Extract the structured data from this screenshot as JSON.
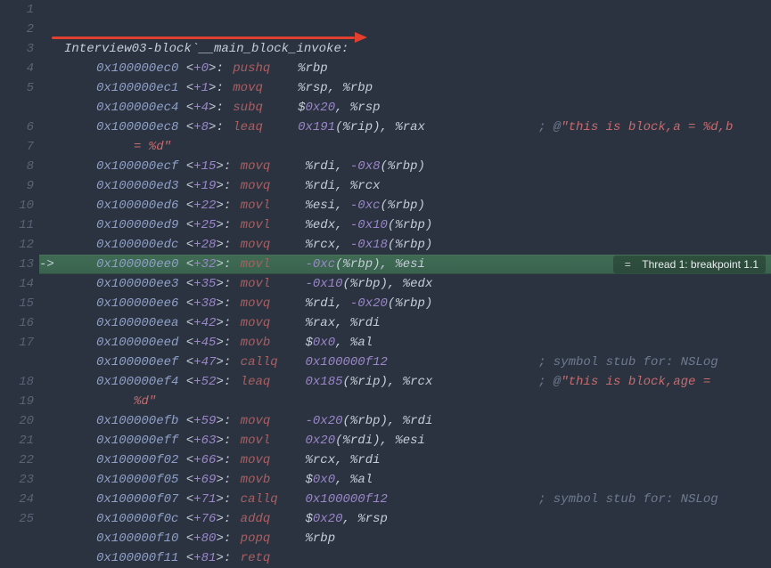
{
  "header": "Interview03-block`__main_block_invoke:",
  "breakpoint_badge": {
    "label": "Thread 1: breakpoint 1.1"
  },
  "current_line_index": 10,
  "lines": [
    {
      "ln": 1,
      "type": "header"
    },
    {
      "ln": 2,
      "addr": "0x100000ec0",
      "off": "+0",
      "mnem": "pushq",
      "ops": [
        {
          "t": "reg",
          "v": "%rbp"
        }
      ]
    },
    {
      "ln": 3,
      "addr": "0x100000ec1",
      "off": "+1",
      "mnem": "movq",
      "ops": [
        {
          "t": "reg",
          "v": "%rsp"
        },
        {
          "t": "sep",
          "v": ", "
        },
        {
          "t": "reg",
          "v": "%rbp"
        }
      ]
    },
    {
      "ln": 4,
      "addr": "0x100000ec4",
      "off": "+4",
      "mnem": "subq",
      "ops": [
        {
          "t": "reg",
          "v": "$"
        },
        {
          "t": "num",
          "v": "0x20"
        },
        {
          "t": "sep",
          "v": ", "
        },
        {
          "t": "reg",
          "v": "%rsp"
        }
      ]
    },
    {
      "ln": 5,
      "addr": "0x100000ec8",
      "off": "+8",
      "mnem": "leaq",
      "ops": [
        {
          "t": "num",
          "v": "0x191"
        },
        {
          "t": "reg",
          "v": "(%rip)"
        },
        {
          "t": "sep",
          "v": ", "
        },
        {
          "t": "reg",
          "v": "%rax"
        }
      ],
      "tail_comment": "; @",
      "tail_string": "\"this is block,a = %d,b",
      "wrap_string": "= %d\""
    },
    {
      "ln": 6,
      "addr": "0x100000ecf",
      "off": "+15",
      "mnem": "movq",
      "ops": [
        {
          "t": "reg",
          "v": "%rdi"
        },
        {
          "t": "sep",
          "v": ", "
        },
        {
          "t": "num",
          "v": "-0x8"
        },
        {
          "t": "reg",
          "v": "(%rbp)"
        }
      ]
    },
    {
      "ln": 7,
      "addr": "0x100000ed3",
      "off": "+19",
      "mnem": "movq",
      "ops": [
        {
          "t": "reg",
          "v": "%rdi"
        },
        {
          "t": "sep",
          "v": ", "
        },
        {
          "t": "reg",
          "v": "%rcx"
        }
      ]
    },
    {
      "ln": 8,
      "addr": "0x100000ed6",
      "off": "+22",
      "mnem": "movl",
      "ops": [
        {
          "t": "reg",
          "v": "%esi"
        },
        {
          "t": "sep",
          "v": ", "
        },
        {
          "t": "num",
          "v": "-0xc"
        },
        {
          "t": "reg",
          "v": "(%rbp)"
        }
      ]
    },
    {
      "ln": 9,
      "addr": "0x100000ed9",
      "off": "+25",
      "mnem": "movl",
      "ops": [
        {
          "t": "reg",
          "v": "%edx"
        },
        {
          "t": "sep",
          "v": ", "
        },
        {
          "t": "num",
          "v": "-0x10"
        },
        {
          "t": "reg",
          "v": "(%rbp)"
        }
      ]
    },
    {
      "ln": 10,
      "addr": "0x100000edc",
      "off": "+28",
      "mnem": "movq",
      "ops": [
        {
          "t": "reg",
          "v": "%rcx"
        },
        {
          "t": "sep",
          "v": ", "
        },
        {
          "t": "num",
          "v": "-0x18"
        },
        {
          "t": "reg",
          "v": "(%rbp)"
        }
      ]
    },
    {
      "ln": 11,
      "addr": "0x100000ee0",
      "off": "+32",
      "mnem": "movl",
      "ops": [
        {
          "t": "num",
          "v": "-0xc"
        },
        {
          "t": "reg",
          "v": "(%rbp)"
        },
        {
          "t": "sep",
          "v": ", "
        },
        {
          "t": "reg",
          "v": "%esi"
        }
      ],
      "current": true
    },
    {
      "ln": 12,
      "addr": "0x100000ee3",
      "off": "+35",
      "mnem": "movl",
      "ops": [
        {
          "t": "num",
          "v": "-0x10"
        },
        {
          "t": "reg",
          "v": "(%rbp)"
        },
        {
          "t": "sep",
          "v": ", "
        },
        {
          "t": "reg",
          "v": "%edx"
        }
      ]
    },
    {
      "ln": 13,
      "addr": "0x100000ee6",
      "off": "+38",
      "mnem": "movq",
      "ops": [
        {
          "t": "reg",
          "v": "%rdi"
        },
        {
          "t": "sep",
          "v": ", "
        },
        {
          "t": "num",
          "v": "-0x20"
        },
        {
          "t": "reg",
          "v": "(%rbp)"
        }
      ]
    },
    {
      "ln": 14,
      "addr": "0x100000eea",
      "off": "+42",
      "mnem": "movq",
      "ops": [
        {
          "t": "reg",
          "v": "%rax"
        },
        {
          "t": "sep",
          "v": ", "
        },
        {
          "t": "reg",
          "v": "%rdi"
        }
      ]
    },
    {
      "ln": 15,
      "addr": "0x100000eed",
      "off": "+45",
      "mnem": "movb",
      "ops": [
        {
          "t": "reg",
          "v": "$"
        },
        {
          "t": "num",
          "v": "0x0"
        },
        {
          "t": "sep",
          "v": ", "
        },
        {
          "t": "reg",
          "v": "%al"
        }
      ]
    },
    {
      "ln": 16,
      "addr": "0x100000eef",
      "off": "+47",
      "mnem": "callq",
      "ops": [
        {
          "t": "num",
          "v": "0x100000f12"
        }
      ],
      "tail_comment": "; symbol stub for: NSLog"
    },
    {
      "ln": 17,
      "addr": "0x100000ef4",
      "off": "+52",
      "mnem": "leaq",
      "ops": [
        {
          "t": "num",
          "v": "0x185"
        },
        {
          "t": "reg",
          "v": "(%rip)"
        },
        {
          "t": "sep",
          "v": ", "
        },
        {
          "t": "reg",
          "v": "%rcx"
        }
      ],
      "tail_comment": "; @",
      "tail_string": "\"this is block,age = ",
      "wrap_string": "%d\""
    },
    {
      "ln": 18,
      "addr": "0x100000efb",
      "off": "+59",
      "mnem": "movq",
      "ops": [
        {
          "t": "num",
          "v": "-0x20"
        },
        {
          "t": "reg",
          "v": "(%rbp)"
        },
        {
          "t": "sep",
          "v": ", "
        },
        {
          "t": "reg",
          "v": "%rdi"
        }
      ]
    },
    {
      "ln": 19,
      "addr": "0x100000eff",
      "off": "+63",
      "mnem": "movl",
      "ops": [
        {
          "t": "num",
          "v": "0x20"
        },
        {
          "t": "reg",
          "v": "(%rdi)"
        },
        {
          "t": "sep",
          "v": ", "
        },
        {
          "t": "reg",
          "v": "%esi"
        }
      ]
    },
    {
      "ln": 20,
      "addr": "0x100000f02",
      "off": "+66",
      "mnem": "movq",
      "ops": [
        {
          "t": "reg",
          "v": "%rcx"
        },
        {
          "t": "sep",
          "v": ", "
        },
        {
          "t": "reg",
          "v": "%rdi"
        }
      ]
    },
    {
      "ln": 21,
      "addr": "0x100000f05",
      "off": "+69",
      "mnem": "movb",
      "ops": [
        {
          "t": "reg",
          "v": "$"
        },
        {
          "t": "num",
          "v": "0x0"
        },
        {
          "t": "sep",
          "v": ", "
        },
        {
          "t": "reg",
          "v": "%al"
        }
      ]
    },
    {
      "ln": 22,
      "addr": "0x100000f07",
      "off": "+71",
      "mnem": "callq",
      "ops": [
        {
          "t": "num",
          "v": "0x100000f12"
        }
      ],
      "tail_comment": "; symbol stub for: NSLog"
    },
    {
      "ln": 23,
      "addr": "0x100000f0c",
      "off": "+76",
      "mnem": "addq",
      "ops": [
        {
          "t": "reg",
          "v": "$"
        },
        {
          "t": "num",
          "v": "0x20"
        },
        {
          "t": "sep",
          "v": ", "
        },
        {
          "t": "reg",
          "v": "%rsp"
        }
      ]
    },
    {
      "ln": 24,
      "addr": "0x100000f10",
      "off": "+80",
      "mnem": "popq",
      "ops": [
        {
          "t": "reg",
          "v": "%rbp"
        }
      ]
    },
    {
      "ln": 25,
      "addr": "0x100000f11",
      "off": "+81",
      "mnem": "retq",
      "ops": []
    }
  ]
}
